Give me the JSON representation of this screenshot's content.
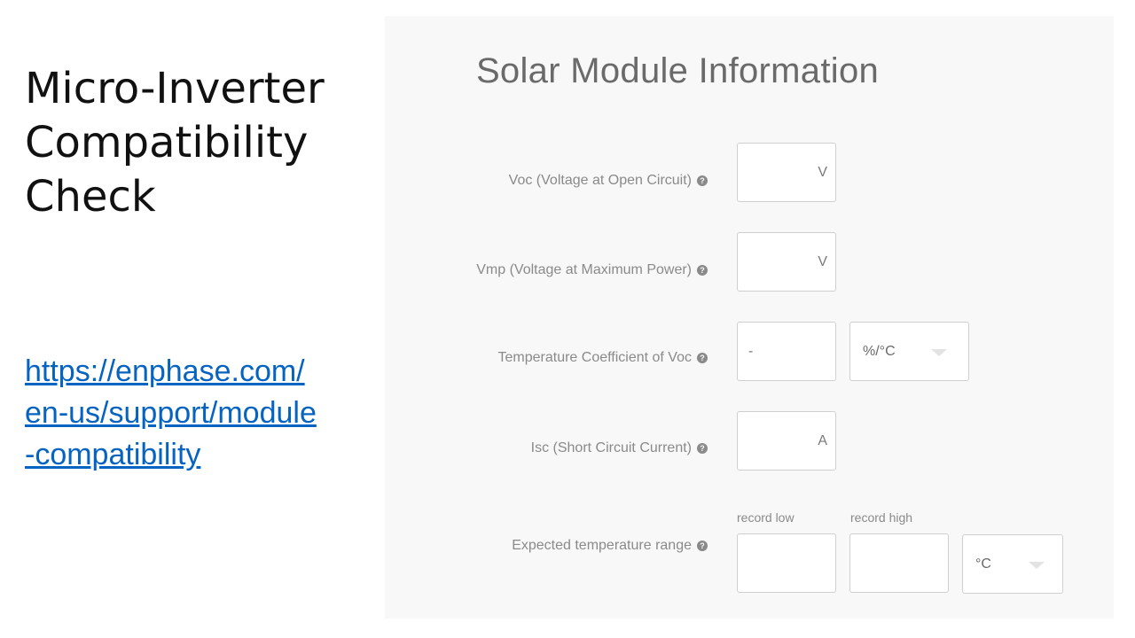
{
  "slide": {
    "title_lines": [
      "Micro-Inverter",
      "Compatibility",
      "Check"
    ],
    "link_lines": [
      "https://enphase.com/",
      "en-us/support/module",
      "-compatibility"
    ]
  },
  "form": {
    "title": "Solar Module Information",
    "help_icon_glyph": "?",
    "voc": {
      "label": "Voc (Voltage at Open Circuit)",
      "unit": "V"
    },
    "vmp": {
      "label": "Vmp (Voltage at Maximum Power)",
      "unit": "V"
    },
    "temp_coeff": {
      "label": "Temperature Coefficient of Voc",
      "prefix": "-",
      "unit_select": "%/°C"
    },
    "isc": {
      "label": "Isc (Short Circuit Current)",
      "unit": "A"
    },
    "temp_range": {
      "label": "Expected temperature range",
      "low_label": "record low",
      "high_label": "record high",
      "unit_select": "°C"
    }
  },
  "colors": {
    "link": "#0563c1",
    "panel_bg": "#f8f8f8",
    "muted_text": "#8a8a8a"
  }
}
